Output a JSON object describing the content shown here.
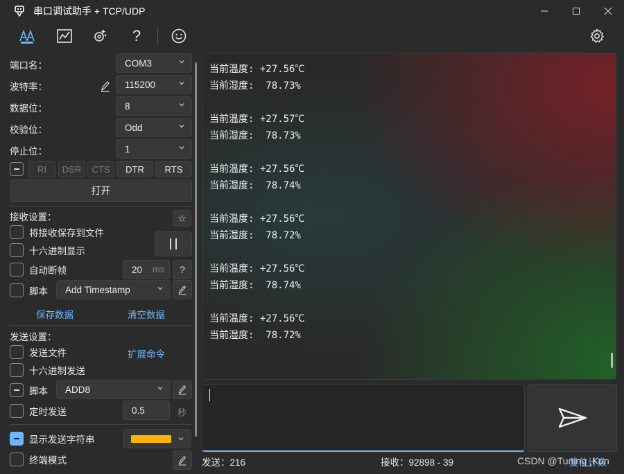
{
  "titlebar": {
    "title": "串口调试助手 + TCP/UDP"
  },
  "toolbar": {
    "tabs": [
      "text-tab-icon",
      "chart-tab-icon",
      "extensions-tab-icon",
      "help-icon",
      "smiley-icon"
    ],
    "settings": "gear-icon"
  },
  "serial": {
    "port_label": "端口名：",
    "port_value": "COM3",
    "baud_label": "波特率：",
    "baud_value": "115200",
    "databits_label": "数据位：",
    "databits_value": "8",
    "parity_label": "校验位：",
    "parity_value": "Odd",
    "stopbits_label": "停止位：",
    "stopbits_value": "1",
    "signals": [
      "RI",
      "DSR",
      "CTS",
      "DTR",
      "RTS"
    ],
    "open_button": "打开"
  },
  "receive": {
    "header": "接收设置：",
    "save_to_file": "将接收保存到文件",
    "hex_display": "十六进制显示",
    "auto_frame": "自动断帧",
    "auto_frame_value": "20",
    "auto_frame_unit": "ms",
    "script_label": "脚本",
    "script_value": "Add Timestamp",
    "save_data": "保存数据",
    "clear_data": "清空数据"
  },
  "send": {
    "header": "发送设置：",
    "send_file": "发送文件",
    "extend_cmd": "扩展命令",
    "hex_send": "十六进制发送",
    "script_label": "脚本",
    "script_value": "ADD8",
    "timed_send": "定时发送",
    "timed_value": "0.5",
    "timed_unit": "秒",
    "show_send_string": "显示发送字符串",
    "show_send_color": "#ffb300",
    "terminal_mode": "终端模式"
  },
  "rx_lines": [
    "当前温度: +27.56℃",
    "当前湿度:  78.73%",
    "当前温度: +27.57℃",
    "当前湿度:  78.73%",
    "当前温度: +27.56℃",
    "当前湿度:  78.74%",
    "当前温度: +27.56℃",
    "当前湿度:  78.72%",
    "当前温度: +27.56℃",
    "当前湿度:  78.74%",
    "当前温度: +27.56℃",
    "当前湿度:  78.72%"
  ],
  "status": {
    "sent": "发送：216",
    "received": "接收：92898 - 39",
    "reset_count": "复位计数",
    "watermark": "CSDN @Tuning_Kun"
  }
}
